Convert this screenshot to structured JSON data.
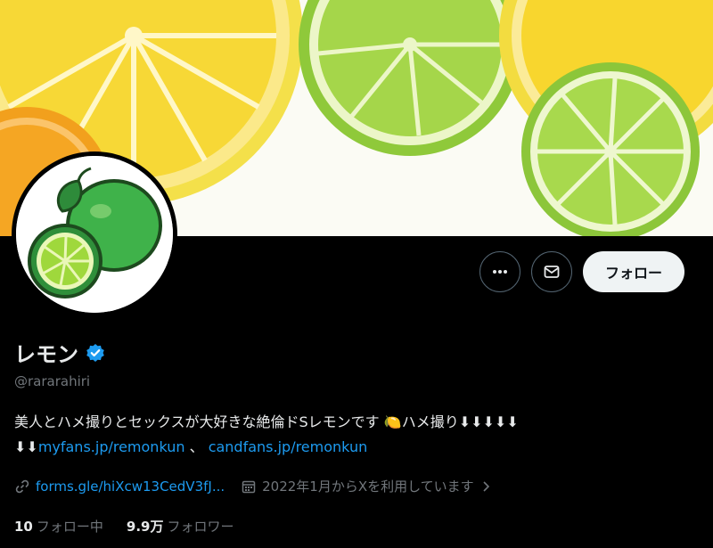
{
  "profile": {
    "display_name": "レモン",
    "handle": "@rararahiri",
    "verified_icon": "verified-badge-icon",
    "bio_text": "美人とハメ撮りとセックスが大好きな絶倫ドSレモンです ",
    "bio_emoji": "🍋",
    "bio_text2": "ハメ撮り⬇⬇⬇⬇⬇",
    "bio_arrows": "⬇⬇",
    "link1": "myfans.jp/remonkun",
    "separator": " 、",
    "link2": "candfans.jp/remonkun",
    "website": "forms.gle/hiXcw13CedV3fJ...",
    "joined": "2022年1月からXを利用しています",
    "following_count": "10",
    "following_label": "フォロー中",
    "followers_count": "9.9万",
    "followers_label": "フォロワー"
  },
  "actions": {
    "more_icon": "more-icon",
    "message_icon": "mail-icon",
    "follow_label": "フォロー"
  },
  "colors": {
    "accent": "#1d9bf0",
    "muted": "#71767b",
    "text": "#e7e9ea",
    "background": "#000000"
  }
}
